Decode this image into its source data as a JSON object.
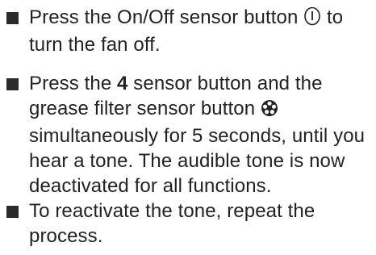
{
  "items": [
    {
      "before": "Press the On/Off sensor button ",
      "icon": "power-icon",
      "after": " to turn the fan off."
    },
    {
      "prefix": "Press the ",
      "bold": "4",
      "mid": " sensor button and the grease filter sensor button ",
      "icon": "grease-filter-icon",
      "suffix": " simultaneously for 5 seconds, until you hear a tone. The audible tone is now deactivated for all functions."
    },
    {
      "text": "To reactivate the tone, repeat the process."
    }
  ]
}
